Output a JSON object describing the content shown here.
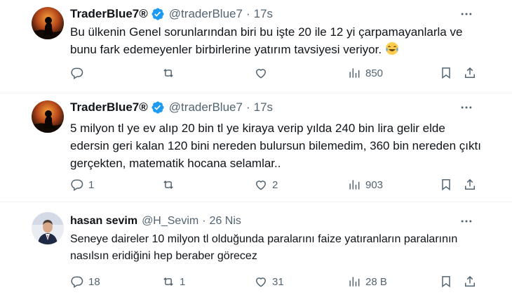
{
  "tweets": [
    {
      "name": "TraderBlue7®",
      "handle": "@traderBlue7",
      "separator": "·",
      "time": "17s",
      "text": "Bu ülkenin Genel sorunlarından biri bu işte 20 ile 12 yi çarpamayanlarla ve bunu fark edemeyenler birbirlerine yatırım tavsiyesi veriyor.",
      "emoji": "face-with-tears-of-joy",
      "verified": true,
      "replies": "",
      "retweets": "",
      "likes": "",
      "views": "850"
    },
    {
      "name": "TraderBlue7®",
      "handle": "@traderBlue7",
      "separator": "·",
      "time": "17s",
      "text": "5 milyon tl ye ev alıp 20 bin tl ye kiraya verip yılda 240 bin lira gelir elde edersin geri kalan 120 bini nereden bulursun bilemedim, 360 bin  nereden çıktı gerçekten, matematik hocana selamlar..",
      "verified": true,
      "replies": "1",
      "retweets": "",
      "likes": "2",
      "views": "903"
    },
    {
      "name": "hasan sevim",
      "handle": "@H_Sevim",
      "separator": "·",
      "time": "26 Nis",
      "text": "Seneye daireler 10 milyon tl olduğunda paralarını faize yatıranların paralarının nasılsın eridiğini hep beraber görecez",
      "verified": false,
      "replies": "18",
      "retweets": "1",
      "likes": "31",
      "views": "28 B"
    }
  ],
  "colors": {
    "text": "#0f1419",
    "secondary": "#536471",
    "verified": "#1d9bf0",
    "divider": "#eff3f4"
  },
  "icons": [
    "reply-icon",
    "retweet-icon",
    "like-icon",
    "views-icon",
    "bookmark-icon",
    "share-icon",
    "more-icon",
    "verified-badge-icon"
  ]
}
